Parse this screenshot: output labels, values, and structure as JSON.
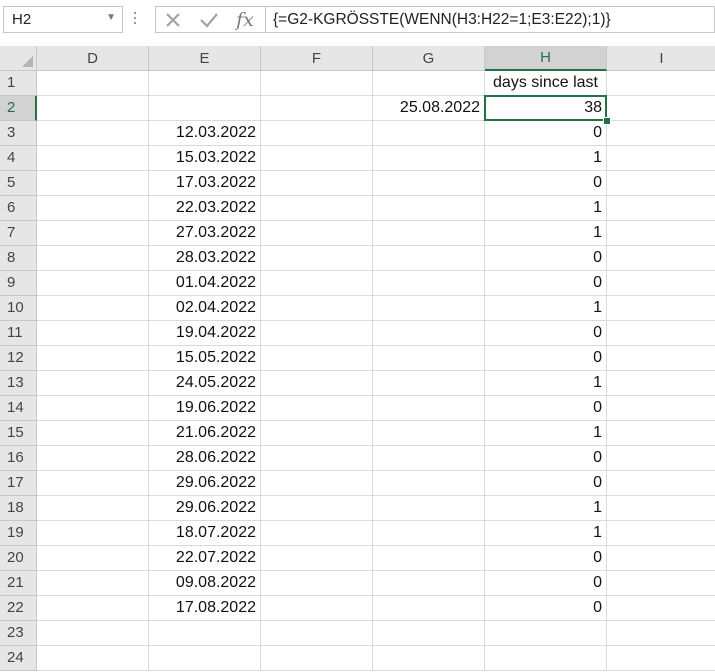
{
  "name_box": {
    "value": "H2"
  },
  "formula_bar": {
    "value": "{=G2-KGRÖSSTE(WENN(H3:H22=1;E3:E22);1)}"
  },
  "columns": [
    "D",
    "E",
    "F",
    "G",
    "H",
    "I"
  ],
  "selected_column": "H",
  "selected_row": "2",
  "rows": [
    {
      "num": "1",
      "E": "",
      "G": "",
      "H": "days since last"
    },
    {
      "num": "2",
      "E": "",
      "G": "25.08.2022",
      "H": "38"
    },
    {
      "num": "3",
      "E": "12.03.2022",
      "G": "",
      "H": "0"
    },
    {
      "num": "4",
      "E": "15.03.2022",
      "G": "",
      "H": "1"
    },
    {
      "num": "5",
      "E": "17.03.2022",
      "G": "",
      "H": "0"
    },
    {
      "num": "6",
      "E": "22.03.2022",
      "G": "",
      "H": "1"
    },
    {
      "num": "7",
      "E": "27.03.2022",
      "G": "",
      "H": "1"
    },
    {
      "num": "8",
      "E": "28.03.2022",
      "G": "",
      "H": "0"
    },
    {
      "num": "9",
      "E": "01.04.2022",
      "G": "",
      "H": "0"
    },
    {
      "num": "10",
      "E": "02.04.2022",
      "G": "",
      "H": "1"
    },
    {
      "num": "11",
      "E": "19.04.2022",
      "G": "",
      "H": "0"
    },
    {
      "num": "12",
      "E": "15.05.2022",
      "G": "",
      "H": "0"
    },
    {
      "num": "13",
      "E": "24.05.2022",
      "G": "",
      "H": "1"
    },
    {
      "num": "14",
      "E": "19.06.2022",
      "G": "",
      "H": "0"
    },
    {
      "num": "15",
      "E": "21.06.2022",
      "G": "",
      "H": "1"
    },
    {
      "num": "16",
      "E": "28.06.2022",
      "G": "",
      "H": "0"
    },
    {
      "num": "17",
      "E": "29.06.2022",
      "G": "",
      "H": "0"
    },
    {
      "num": "18",
      "E": "29.06.2022",
      "G": "",
      "H": "1"
    },
    {
      "num": "19",
      "E": "18.07.2022",
      "G": "",
      "H": "1"
    },
    {
      "num": "20",
      "E": "22.07.2022",
      "G": "",
      "H": "0"
    },
    {
      "num": "21",
      "E": "09.08.2022",
      "G": "",
      "H": "0"
    },
    {
      "num": "22",
      "E": "17.08.2022",
      "G": "",
      "H": "0"
    },
    {
      "num": "23",
      "E": "",
      "G": "",
      "H": ""
    },
    {
      "num": "24",
      "E": "",
      "G": "",
      "H": ""
    }
  ],
  "colors": {
    "accent": "#217346",
    "header_bg": "#e6e6e6",
    "gridline": "#dadada"
  },
  "icons": {
    "cancel": "close-icon",
    "enter": "checkmark-icon",
    "function": "fx-icon",
    "namebox_dropdown": "chevron-down-icon"
  }
}
